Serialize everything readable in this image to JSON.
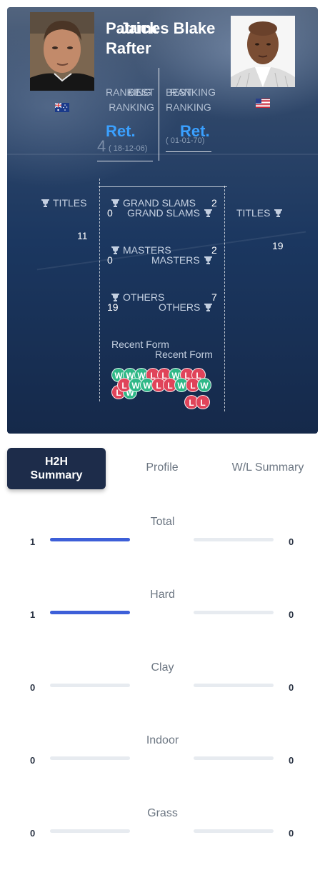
{
  "player1": {
    "name": "Patrick Rafter",
    "flag": "au-flag",
    "best_ranking_label": "BEST RANKING",
    "ranking_label": "RANKING",
    "ranking_value": "Ret.",
    "best_rank_number": "4",
    "best_rank_date": "( 18-12-06)",
    "titles_label": "TITLES",
    "titles": "11",
    "grand_slams": "2",
    "masters": "2",
    "others": "7"
  },
  "player2": {
    "name": "James Blake",
    "flag": "us-flag",
    "best_ranking_label": "BEST RANKING",
    "ranking_label": "RANKING",
    "ranking_value": "Ret.",
    "best_rank_date": "( 01-01-70)",
    "titles_label": "TITLES",
    "titles": "19",
    "grand_slams": "0",
    "masters": "0",
    "others": "19"
  },
  "labels": {
    "grand_slams": "GRAND SLAMS",
    "masters": "MASTERS",
    "others": "OTHERS",
    "recent_form": "Recent Form"
  },
  "recent_form": {
    "player1": [
      "W",
      "W",
      "W",
      "L",
      "L",
      "W",
      "L",
      "L",
      "L",
      "W"
    ],
    "player2": [
      "L",
      "W",
      "W",
      "L",
      "L",
      "W",
      "L",
      "W",
      "L",
      "L"
    ]
  },
  "tabs": {
    "h2h": "H2H Summary",
    "profile": "Profile",
    "wl": "W/L Summary"
  },
  "summary": [
    {
      "label": "Total",
      "p1": "1",
      "p2": "0",
      "p1_share": 1.0,
      "p2_share": 0.0
    },
    {
      "label": "Hard",
      "p1": "1",
      "p2": "0",
      "p1_share": 1.0,
      "p2_share": 0.0
    },
    {
      "label": "Clay",
      "p1": "0",
      "p2": "0",
      "p1_share": 0.0,
      "p2_share": 0.0
    },
    {
      "label": "Indoor",
      "p1": "0",
      "p2": "0",
      "p1_share": 0.0,
      "p2_share": 0.0
    },
    {
      "label": "Grass",
      "p1": "0",
      "p2": "0",
      "p1_share": 0.0,
      "p2_share": 0.0
    }
  ],
  "colors": {
    "win": "#2fb887",
    "loss": "#e0445a",
    "bar": "#3d5fd8",
    "rank": "#3aa0ff"
  }
}
